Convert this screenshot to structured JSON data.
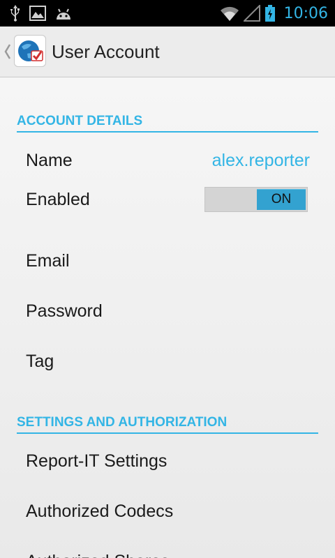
{
  "status_bar": {
    "time": "10:06",
    "left_icons": [
      "usb-icon",
      "image-icon",
      "android-icon"
    ],
    "right_icons": [
      "wifi-icon",
      "signal-icon",
      "battery-icon"
    ],
    "accent_color": "#33b5e5"
  },
  "action_bar": {
    "title": "User Account",
    "logo_icon": "app-logo-icon"
  },
  "sections": {
    "account_details": {
      "header": "ACCOUNT DETAILS",
      "name_label": "Name",
      "name_value": "alex.reporter",
      "enabled_label": "Enabled",
      "enabled_toggle": "ON",
      "email_label": "Email",
      "password_label": "Password",
      "tag_label": "Tag"
    },
    "settings": {
      "header": "SETTINGS AND AUTHORIZATION",
      "report_it_label": "Report-IT Settings",
      "codecs_label": "Authorized Codecs",
      "partial_label": "Authorized Shares"
    }
  },
  "colors": {
    "accent": "#33b5e5",
    "toggle_on": "#33a2d0",
    "background": "#f2f2f2"
  }
}
